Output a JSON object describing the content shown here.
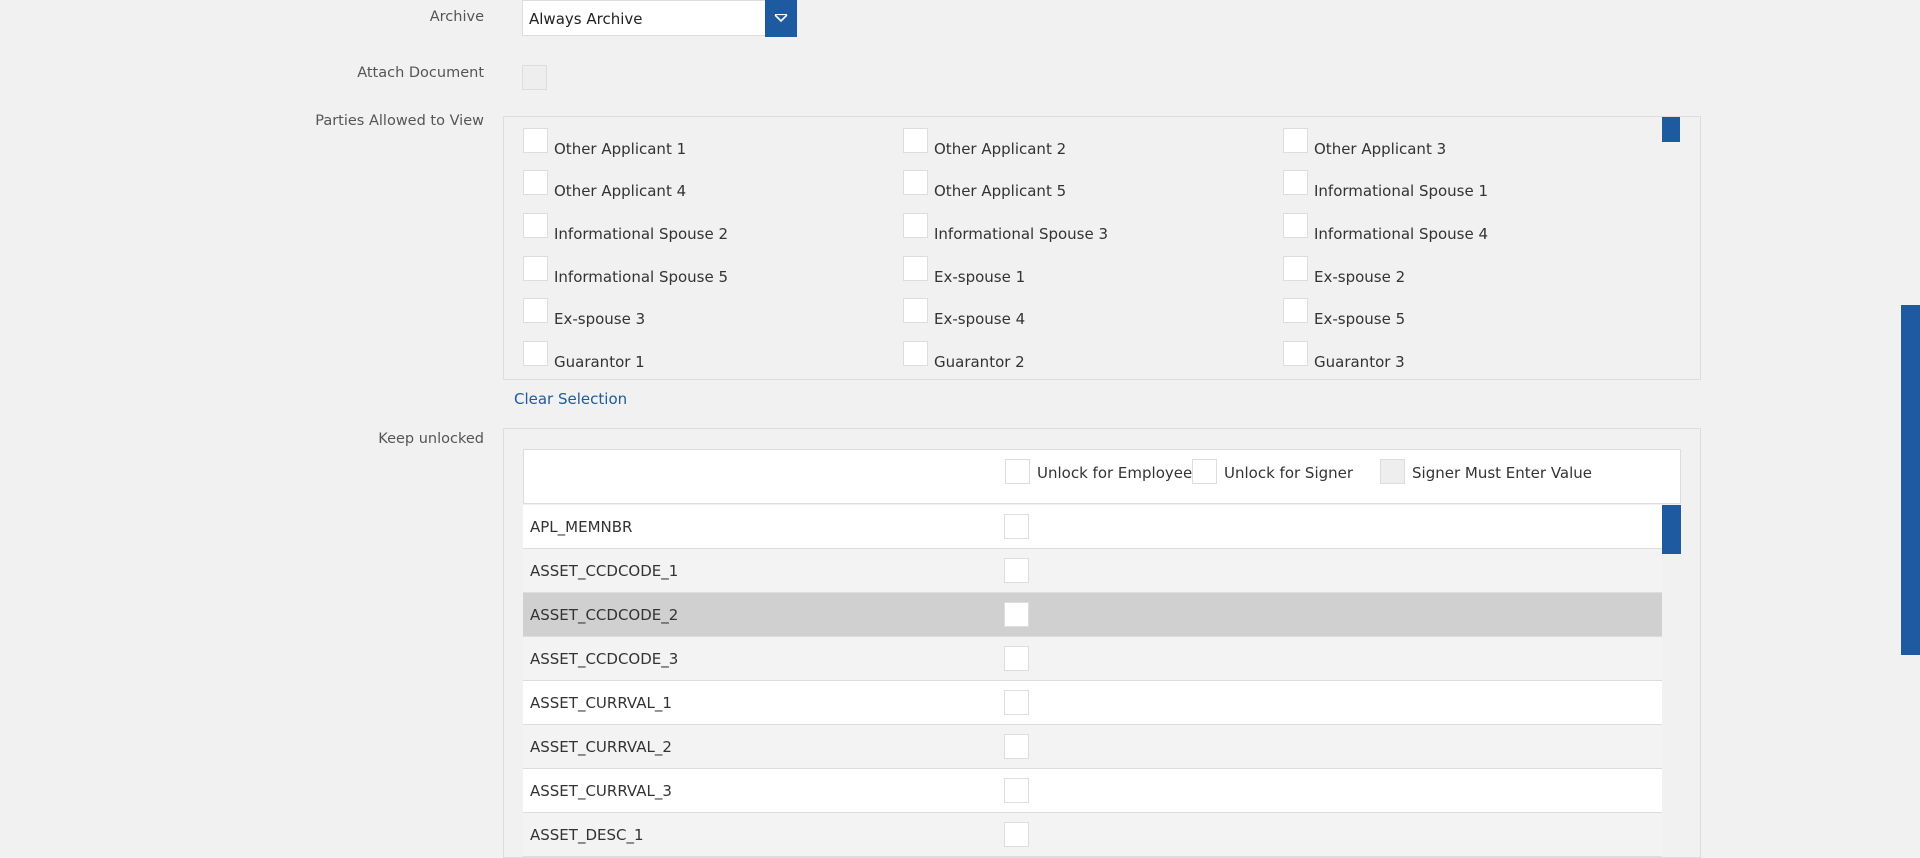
{
  "archive": {
    "label": "Archive",
    "value": "Always Archive"
  },
  "attach": {
    "label": "Attach Document"
  },
  "parties": {
    "label": "Parties Allowed to View",
    "items": [
      "Other Applicant 1",
      "Other Applicant 2",
      "Other Applicant 3",
      "Other Applicant 4",
      "Other Applicant 5",
      "Informational Spouse 1",
      "Informational Spouse 2",
      "Informational Spouse 3",
      "Informational Spouse 4",
      "Informational Spouse 5",
      "Ex-spouse 1",
      "Ex-spouse 2",
      "Ex-spouse 3",
      "Ex-spouse 4",
      "Ex-spouse 5",
      "Guarantor 1",
      "Guarantor 2",
      "Guarantor 3"
    ],
    "clear_label": "Clear Selection"
  },
  "unlock": {
    "label": "Keep unlocked",
    "headers": [
      "Unlock for Employee",
      "Unlock for Signer",
      "Signer Must Enter Value"
    ],
    "rows": [
      "APL_MEMNBR",
      "ASSET_CCDCODE_1",
      "ASSET_CCDCODE_2",
      "ASSET_CCDCODE_3",
      "ASSET_CURRVAL_1",
      "ASSET_CURRVAL_2",
      "ASSET_CURRVAL_3",
      "ASSET_DESC_1"
    ],
    "selected_row": "ASSET_CCDCODE_2"
  },
  "colors": {
    "accent": "#1e5aa0",
    "link": "#1e5aa0",
    "selected_row": "#d0d0d0"
  }
}
